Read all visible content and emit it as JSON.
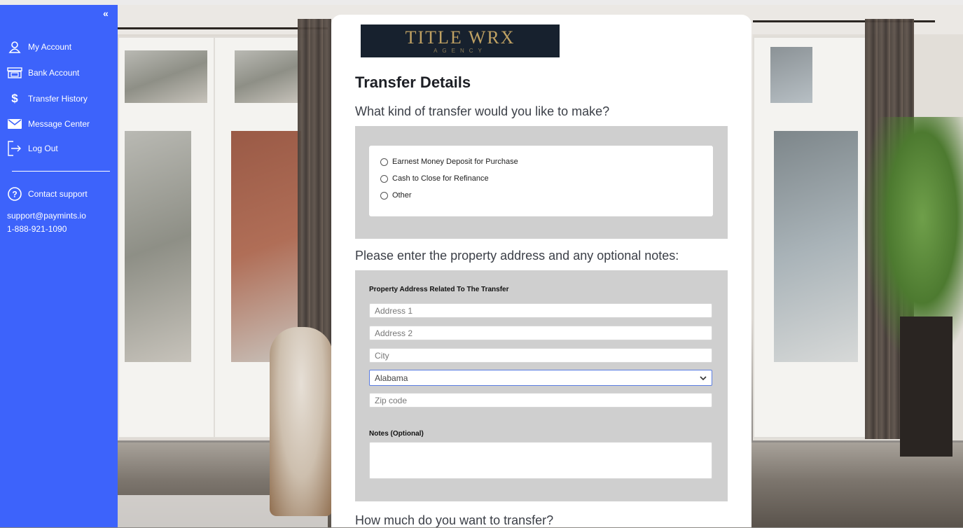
{
  "sidebar": {
    "collapse_icon": "double-chevron-left-icon",
    "items": [
      {
        "label": "My Account",
        "icon": "user-icon"
      },
      {
        "label": "Bank Account",
        "icon": "bank-icon"
      },
      {
        "label": "Transfer History",
        "icon": "dollar-icon"
      },
      {
        "label": "Message Center",
        "icon": "envelope-icon"
      },
      {
        "label": "Log Out",
        "icon": "logout-icon"
      }
    ],
    "support": {
      "label": "Contact support",
      "icon": "help-circle-icon",
      "email": "support@paymints.io",
      "phone": "1-888-921-1090"
    },
    "color": "#3d63fb"
  },
  "logo": {
    "title": "TITLE WRX",
    "subtitle": "AGENCY"
  },
  "form": {
    "title": "Transfer Details",
    "question1": "What kind of transfer would you like to make?",
    "transfer_options": [
      "Earnest Money Deposit for Purchase",
      "Cash to Close for Refinance",
      "Other"
    ],
    "question2": "Please enter the property address and any optional notes:",
    "address_label": "Property Address Related To The Transfer",
    "address1_placeholder": "Address 1",
    "address2_placeholder": "Address 2",
    "city_placeholder": "City",
    "state_value": "Alabama",
    "zip_placeholder": "Zip code",
    "notes_label": "Notes (Optional)",
    "question3": "How much do you want to transfer?"
  }
}
